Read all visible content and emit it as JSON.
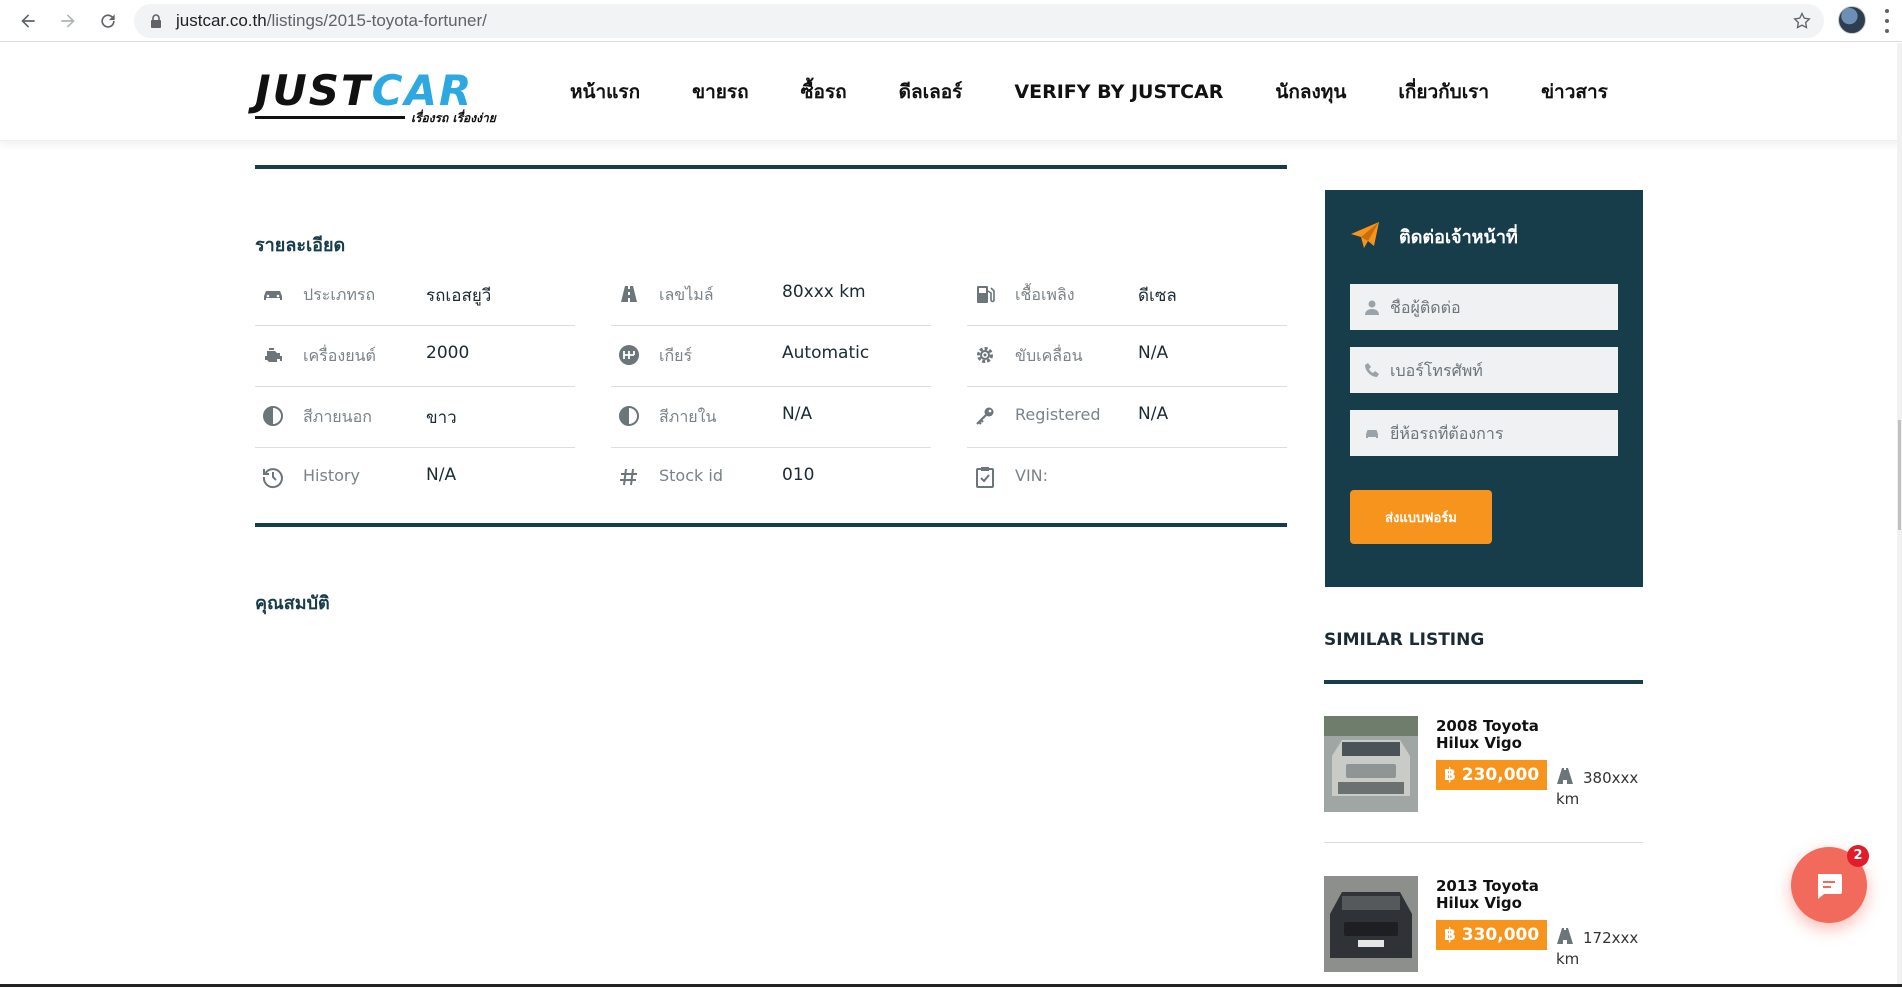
{
  "browser": {
    "url_host": "justcar.co.th",
    "url_path": "/listings/2015-toyota-fortuner/"
  },
  "site": {
    "logo_just": "JUST",
    "logo_car": "CAR",
    "logo_tagline": "เรื่องรถ เรื่องง่าย",
    "nav": [
      "หน้าแรก",
      "ขายรถ",
      "ซื้อรถ",
      "ดีลเลอร์",
      "VERIFY BY JUSTCAR",
      "นักลงทุน",
      "เกี่ยวกับเรา",
      "ข่าวสาร"
    ]
  },
  "details": {
    "title": "รายละเอียด",
    "rows": [
      [
        {
          "icon": "car-icon",
          "label": "ประเภทรถ",
          "value": "รถเอสยูวี"
        },
        {
          "icon": "road-icon",
          "label": "เลขไมล์",
          "value": "80xxx km"
        },
        {
          "icon": "fuel-pump-icon",
          "label": "เชื้อเพลิง",
          "value": "ดีเซล"
        }
      ],
      [
        {
          "icon": "engine-icon",
          "label": "เครื่องยนต์",
          "value": "2000"
        },
        {
          "icon": "gearbox-icon",
          "label": "เกียร์",
          "value": "Automatic"
        },
        {
          "icon": "drivetrain-gear-icon",
          "label": "ขับเคลื่อน",
          "value": "N/A"
        }
      ],
      [
        {
          "icon": "half-circle-icon",
          "label": "สีภายนอก",
          "value": "ขาว"
        },
        {
          "icon": "half-circle-icon",
          "label": "สีภายใน",
          "value": "N/A"
        },
        {
          "icon": "key-icon",
          "label": "Registered",
          "value": "N/A"
        }
      ],
      [
        {
          "icon": "history-clock-icon",
          "label": "History",
          "value": "N/A"
        },
        {
          "icon": "hash-icon",
          "label": "Stock id",
          "value": "010"
        },
        {
          "icon": "clipboard-check-icon",
          "label": "VIN:",
          "value": ""
        }
      ]
    ],
    "features_title": "คุณสมบัติ"
  },
  "contact": {
    "title": "ติดต่อเจ้าหน้าที่",
    "name_placeholder": "ชื่อผู้ติดต่อ",
    "phone_placeholder": "เบอร์โทรศัพท์",
    "brand_placeholder": "ยี่ห้อรถที่ต้องการ",
    "submit_label": "ส่งแบบฟอร์ม"
  },
  "similar": {
    "title": "SIMILAR LISTING",
    "items": [
      {
        "title": "2008 Toyota Hilux Vigo",
        "price": "฿ 230,000",
        "mileage": "380xxx km"
      },
      {
        "title": "2013 Toyota Hilux Vigo",
        "price": "฿ 330,000",
        "mileage": "172xxx km"
      }
    ]
  },
  "chat": {
    "badge": "2"
  },
  "colors": {
    "primary": "#173d4a",
    "accent": "#f7941d",
    "chat": "#f26a5b"
  }
}
